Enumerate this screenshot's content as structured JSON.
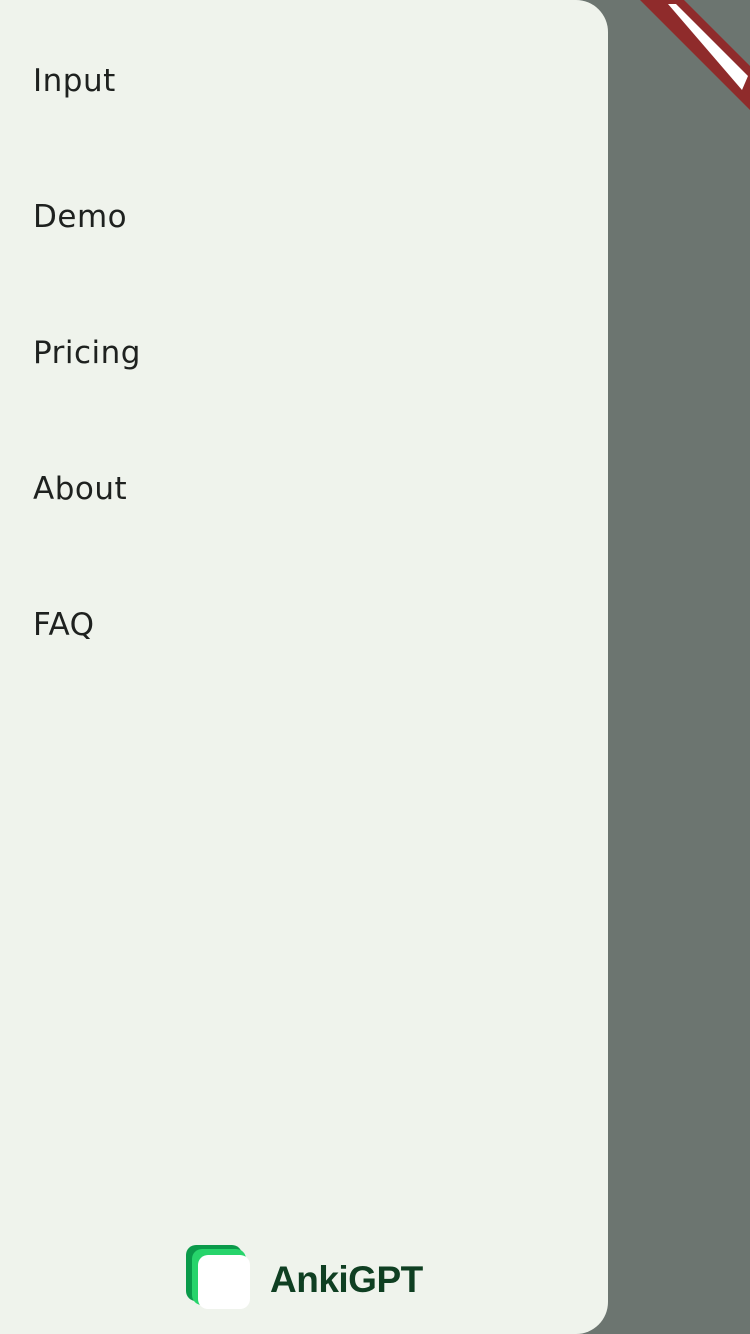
{
  "drawer": {
    "nav_items": [
      {
        "label": "Input"
      },
      {
        "label": "Demo"
      },
      {
        "label": "Pricing"
      },
      {
        "label": "About"
      },
      {
        "label": "FAQ"
      }
    ]
  },
  "brand": {
    "name": "AnkiGPT",
    "logo_icon": "stacked-cards-logo",
    "colors": {
      "logo_back": "#0a9a4a",
      "logo_mid": "#27d46b",
      "logo_front": "#ffffff",
      "text": "#0f3f22"
    }
  },
  "colors": {
    "drawer_background": "#eff3ec",
    "scrim": "#6c7570",
    "banner": "#8f2b2b"
  }
}
